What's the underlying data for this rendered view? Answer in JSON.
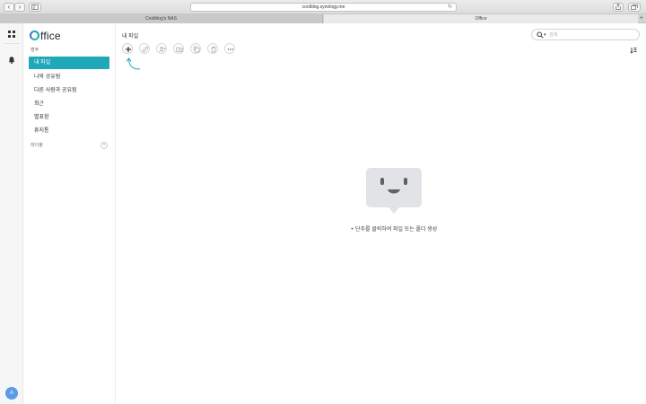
{
  "browser": {
    "url": "coolblog.synology.me",
    "tabs": [
      {
        "label": "Coolblog's NAS",
        "active": false
      },
      {
        "label": "Office",
        "active": true
      }
    ],
    "add_tab_label": "+"
  },
  "rail": {
    "avatar_initial": "A"
  },
  "sidebar": {
    "logo_rest": "ffice",
    "section_label": "범주",
    "items": [
      {
        "label": "내 파일",
        "active": true
      },
      {
        "label": "나와 공유됨",
        "active": false
      },
      {
        "label": "다른 사람과 공유됨",
        "active": false
      },
      {
        "label": "최근",
        "active": false
      },
      {
        "label": "별표함",
        "active": false
      },
      {
        "label": "휴지통",
        "active": false
      }
    ],
    "labels_heading": "레이블",
    "labels_add": "+"
  },
  "main": {
    "title": "내 파일",
    "search": {
      "placeholder": "검색"
    },
    "empty_message": "+ 단추를 클릭하여 파일 또는 폴더 생성"
  },
  "colors": {
    "accent": "#1fa8b8",
    "avatar": "#5b9ae6",
    "empty_illustration": "#e2e3e6"
  },
  "icons": {
    "toolbar": [
      "plus-icon",
      "link-icon",
      "share-user-icon",
      "move-folder-icon",
      "copy-icon",
      "trash-icon",
      "more-icon"
    ],
    "rail": [
      "apps-grid-icon",
      "bell-icon"
    ],
    "view": "sort-icon"
  }
}
